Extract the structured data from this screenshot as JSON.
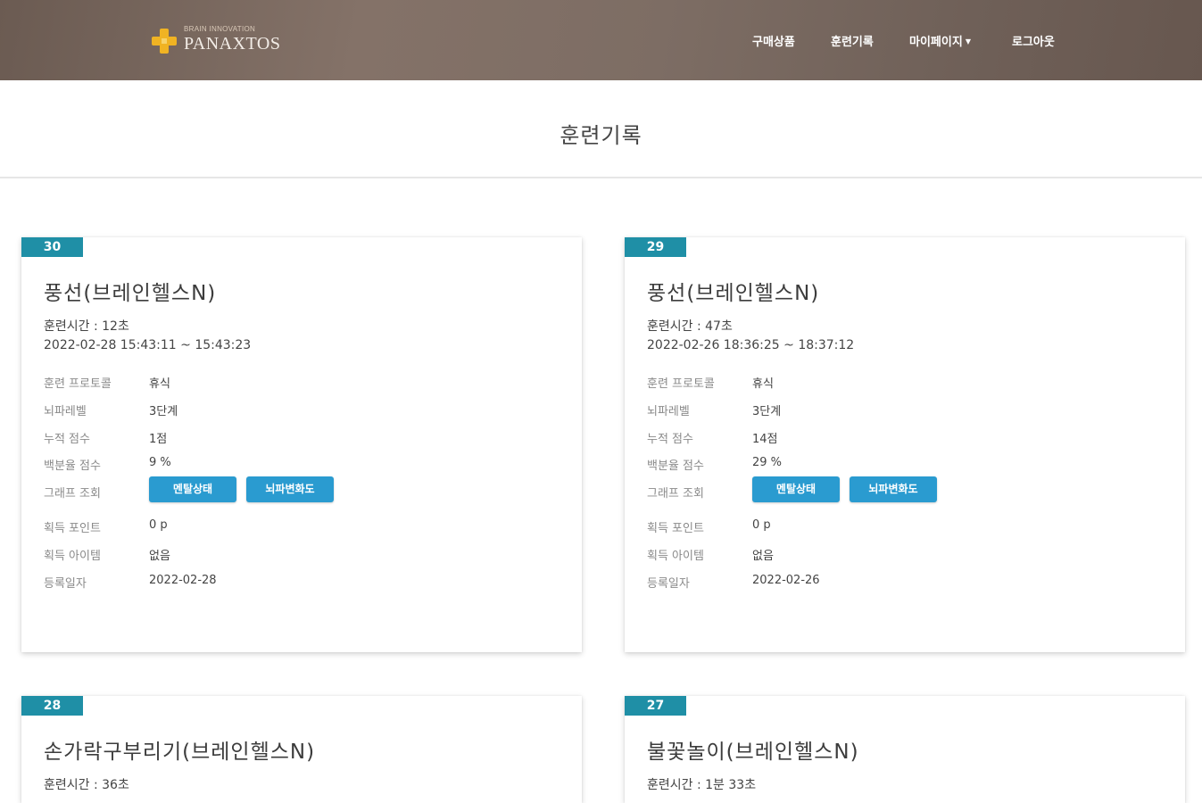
{
  "brand": {
    "tagline": "BRAIN INNOVATION",
    "name": "PANAXTOS"
  },
  "nav": {
    "products": "구매상품",
    "training": "훈련기록",
    "mypage": "마이페이지",
    "logout": "로그아웃"
  },
  "page_title": "훈련기록",
  "labels": {
    "protocol": "훈련 프로토콜",
    "brain_level": "뇌파레벨",
    "score": "누적 점수",
    "percent": "백분율 점수",
    "graph": "그래프 조회",
    "points": "획득 포인트",
    "items": "획득 아이템",
    "reg_date": "등록일자"
  },
  "buttons": {
    "mental": "멘탈상태",
    "brainmap": "뇌파변화도"
  },
  "records": [
    {
      "no": "30",
      "title": "풍선(브레인헬스N)",
      "duration": "훈련시간 : 12초",
      "range": "2022-02-28 15:43:11 ~ 15:43:23",
      "protocol": "휴식",
      "brain_level": "3단계",
      "score": "1점",
      "percent": "9 %",
      "points": "0 p",
      "items": "없음",
      "reg_date": "2022-02-28"
    },
    {
      "no": "29",
      "title": "풍선(브레인헬스N)",
      "duration": "훈련시간 : 47초",
      "range": "2022-02-26 18:36:25 ~ 18:37:12",
      "protocol": "휴식",
      "brain_level": "3단계",
      "score": "14점",
      "percent": "29 %",
      "points": "0 p",
      "items": "없음",
      "reg_date": "2022-02-26"
    },
    {
      "no": "28",
      "title": "손가락구부리기(브레인헬스N)",
      "duration": "훈련시간 : 36초"
    },
    {
      "no": "27",
      "title": "불꽃놀이(브레인헬스N)",
      "duration": "훈련시간 : 1분 33초"
    }
  ],
  "colors": {
    "badge": "#1f8fa6",
    "button": "#2a9bd0",
    "header": "#7a6a60"
  },
  "icons": {
    "logo": "cross-logo-icon",
    "dropdown": "caret-down-icon"
  }
}
